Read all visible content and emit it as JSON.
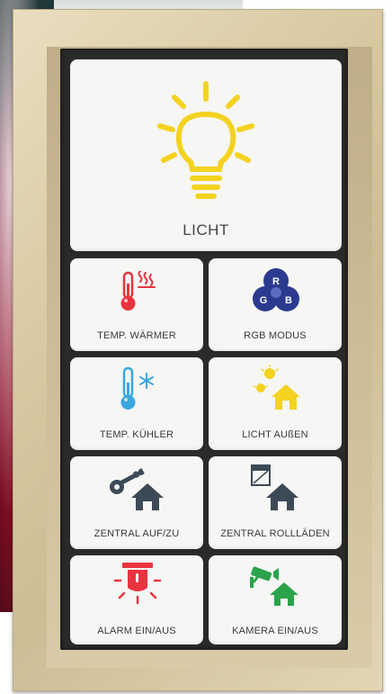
{
  "tiles": {
    "licht": {
      "label": "LICHT",
      "icon": "lightbulb-icon",
      "color": "#f4d21f"
    },
    "temp_waermer": {
      "label": "TEMP. WÄRMER",
      "icon": "thermometer-heat-icon",
      "color": "#e8343f"
    },
    "rgb_modus": {
      "label": "RGB MODUS",
      "icon": "rgb-circles-icon",
      "color": "#2b3a8f",
      "letters": [
        "R",
        "G",
        "B"
      ]
    },
    "temp_kuehler": {
      "label": "TEMP. KÜHLER",
      "icon": "thermometer-cold-icon",
      "color": "#3aa7e0"
    },
    "licht_aussen": {
      "label": "LICHT AUßEN",
      "icon": "house-light-icon",
      "color": "#f4d21f"
    },
    "zentral_auf_zu": {
      "label": "ZENTRAL AUF/ZU",
      "icon": "key-house-icon",
      "color": "#3c4a57"
    },
    "zentral_rolllaeden": {
      "label": "ZENTRAL ROLLLÄDEN",
      "icon": "shutter-house-icon",
      "color": "#3c4a57"
    },
    "alarm_ein_aus": {
      "label": "ALARM EIN/AUS",
      "icon": "alarm-siren-icon",
      "color": "#e8343f"
    },
    "kamera_ein_aus": {
      "label": "KAMERA EIN/AUS",
      "icon": "camera-house-icon",
      "color": "#2aa34a"
    }
  }
}
